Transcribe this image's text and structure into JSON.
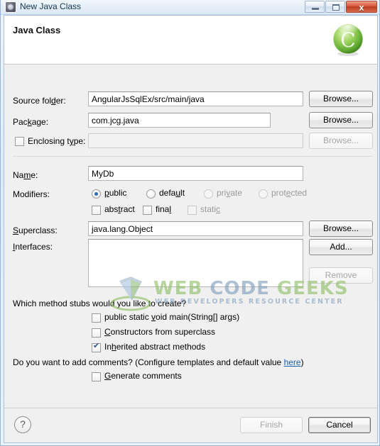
{
  "window": {
    "title": "New Java Class",
    "icon": "eclipse-wizard-icon",
    "buttons": {
      "minimize": "minimize-icon",
      "maximize": "restore-icon",
      "close": "x"
    }
  },
  "header": {
    "title": "Java Class",
    "icon": "java-class-green-c-icon"
  },
  "form": {
    "source_folder": {
      "label_pre": "Source fol",
      "label_mnemonic": "d",
      "label_post": "er:",
      "value": "AngularJsSqlEx/src/main/java",
      "browse": "Browse..."
    },
    "package": {
      "label_pre": "Pac",
      "label_mnemonic": "k",
      "label_post": "age:",
      "value": "com.jcg.java",
      "browse": "Browse..."
    },
    "enclosing_type": {
      "label_pre": "Enclosing t",
      "label_mnemonic": "y",
      "label_post": "pe:",
      "checked": false,
      "value": "",
      "browse": "Browse..."
    },
    "name": {
      "label_pre": "Na",
      "label_mnemonic": "m",
      "label_post": "e:",
      "value": "MyDb"
    },
    "modifiers": {
      "label": "Modifiers:",
      "access": [
        {
          "label_pre": "",
          "label_mnemonic": "p",
          "label_post": "ublic",
          "selected": true,
          "enabled": true
        },
        {
          "label_pre": "defa",
          "label_mnemonic": "u",
          "label_post": "lt",
          "selected": false,
          "enabled": true
        },
        {
          "label_pre": "pri",
          "label_mnemonic": "v",
          "label_post": "ate",
          "selected": false,
          "enabled": false
        },
        {
          "label_pre": "prot",
          "label_mnemonic": "e",
          "label_post": "cted",
          "selected": false,
          "enabled": false
        }
      ],
      "flags": [
        {
          "label_pre": "abs",
          "label_mnemonic": "t",
          "label_post": "ract",
          "checked": false,
          "enabled": true
        },
        {
          "label_pre": "fina",
          "label_mnemonic": "l",
          "label_post": "",
          "checked": false,
          "enabled": true
        },
        {
          "label_pre": "stati",
          "label_mnemonic": "c",
          "label_post": "",
          "checked": false,
          "enabled": false
        }
      ]
    },
    "superclass": {
      "label_pre": "",
      "label_mnemonic": "S",
      "label_post": "uperclass:",
      "value": "java.lang.Object",
      "browse": "Browse..."
    },
    "interfaces": {
      "label_pre": "",
      "label_mnemonic": "I",
      "label_post": "nterfaces:",
      "items": [],
      "add": "Add...",
      "remove": "Remove"
    }
  },
  "stubs": {
    "question": "Which method stubs would you like to create?",
    "options": [
      {
        "label_pre": "public static ",
        "label_mnemonic": "v",
        "label_post": "oid main(String[] args)",
        "checked": false
      },
      {
        "label_pre": "",
        "label_mnemonic": "C",
        "label_post": "onstructors from superclass",
        "checked": false
      },
      {
        "label_pre": "In",
        "label_mnemonic": "h",
        "label_post": "erited abstract methods",
        "checked": true
      }
    ]
  },
  "comments": {
    "text_before": "Do you want to add comments? (Configure templates and default value ",
    "link": "here",
    "text_after": ")",
    "option": {
      "label_pre": "",
      "label_mnemonic": "G",
      "label_post": "enerate comments",
      "checked": false
    }
  },
  "footer": {
    "help": "?",
    "finish": "Finish",
    "finish_enabled": false,
    "cancel": "Cancel",
    "cancel_enabled": true
  },
  "watermark": {
    "word1": "WEB",
    "word2": "CODE",
    "word3": "GEEKS",
    "subtitle": "WEB DEVELOPERS RESOURCE CENTER",
    "green": "#8cbf63",
    "blue": "#7f9dbb"
  }
}
